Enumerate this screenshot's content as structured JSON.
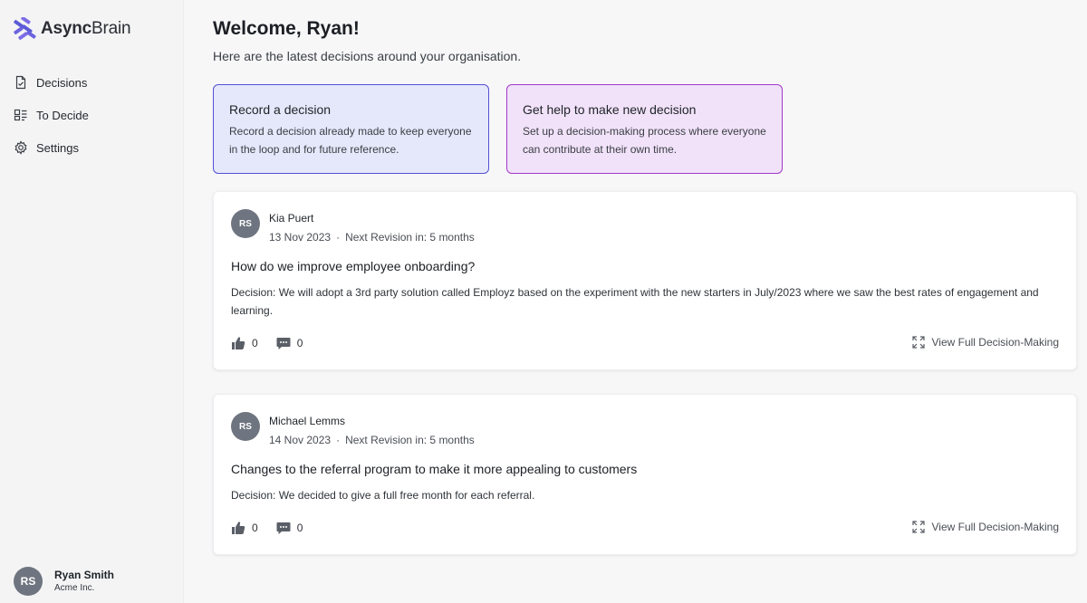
{
  "app": {
    "name_bold": "Async",
    "name_light": "Brain"
  },
  "sidebar": {
    "items": [
      {
        "label": "Decisions",
        "icon": "document-check-icon"
      },
      {
        "label": "To Decide",
        "icon": "board-icon"
      },
      {
        "label": "Settings",
        "icon": "gear-icon"
      }
    ],
    "user": {
      "initials": "RS",
      "name": "Ryan Smith",
      "org": "Acme Inc."
    }
  },
  "main": {
    "welcome": "Welcome, Ryan!",
    "subtitle": "Here are the latest decisions around your organisation.",
    "cards": [
      {
        "title": "Record a decision",
        "description": "Record a decision already made to keep everyone in the loop and for future reference."
      },
      {
        "title": "Get help to make new decision",
        "description": "Set up a decision-making process where everyone can contribute at their own time."
      }
    ],
    "decisions": [
      {
        "initials": "RS",
        "author": "Kia Puert",
        "date": "13 Nov 2023",
        "revision": "Next Revision in: 5 months",
        "question": "How do we improve employee onboarding?",
        "decision": "Decision: We will adopt a 3rd party solution called Employz based on the experiment with the new starters in July/2023 where we saw the best rates of engagement and learning.",
        "likes": "0",
        "comments": "0",
        "view_label": "View Full Decision-Making"
      },
      {
        "initials": "RS",
        "author": "Michael Lemms",
        "date": "14 Nov 2023",
        "revision": "Next Revision in: 5 months",
        "question": "Changes to the referral program to make it more appealing to customers",
        "decision": "Decision: We decided to give a full free month for each referral.",
        "likes": "0",
        "comments": "0",
        "view_label": "View Full Decision-Making"
      }
    ],
    "separator": "·"
  },
  "colors": {
    "brand": "#5b5bd6",
    "record_card_bg": "#e5e8fa",
    "record_card_border": "#5450d6",
    "help_card_bg": "#f1e2f9",
    "help_card_border": "#a338c9",
    "avatar_bg": "#6f7580"
  }
}
